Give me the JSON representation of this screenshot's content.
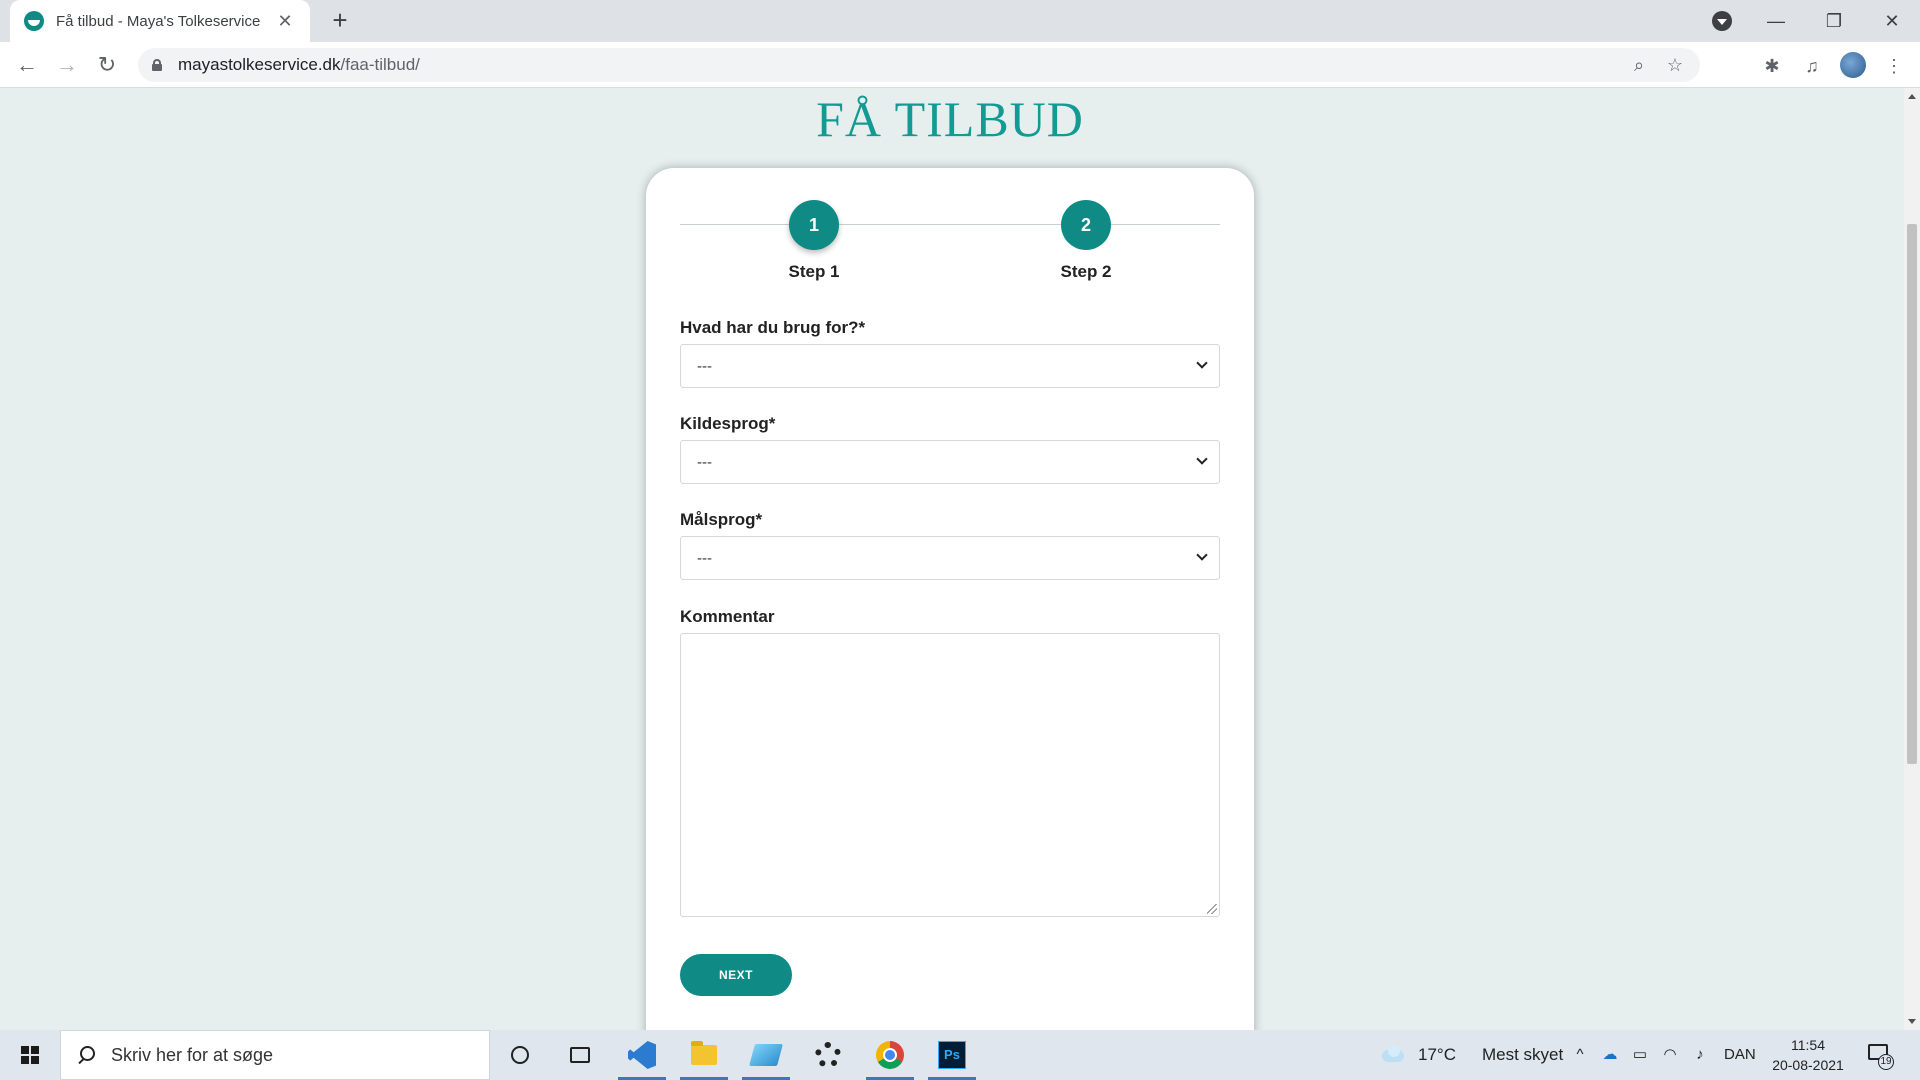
{
  "browser": {
    "tab_title": "Få tilbud - Maya's Tolkeservice",
    "tab_close": "✕",
    "new_tab": "+",
    "url_host": "mayastolkeservice.dk",
    "url_path": "/faa-tilbud/",
    "nav": {
      "back": "←",
      "forward": "→",
      "reload": "↻"
    },
    "window_controls": {
      "minimize": "—",
      "restore": "❐",
      "close": "✕"
    }
  },
  "page": {
    "title": "FÅ TILBUD",
    "steps": [
      {
        "number": "1",
        "label": "Step 1"
      },
      {
        "number": "2",
        "label": "Step 2"
      }
    ],
    "fields": {
      "need": {
        "label": "Hvad har du brug for?*",
        "value": "---"
      },
      "source_lang": {
        "label": "Kildesprog*",
        "value": "---"
      },
      "target_lang": {
        "label": "Målsprog*",
        "value": "---"
      },
      "comment": {
        "label": "Kommentar",
        "value": ""
      }
    },
    "next_button": "NEXT",
    "accent_color": "#0f8a85"
  },
  "taskbar": {
    "search_placeholder": "Skriv her for at søge",
    "weather_temp": "17°C",
    "weather_desc": "Mest skyet",
    "language": "DAN",
    "time": "11:54",
    "date": "20-08-2021",
    "notification_count": "19",
    "apps": [
      "cortana",
      "task-view",
      "vscode",
      "file-explorer",
      "notepad",
      "settings",
      "chrome",
      "photoshop"
    ],
    "photoshop_label": "Ps"
  }
}
